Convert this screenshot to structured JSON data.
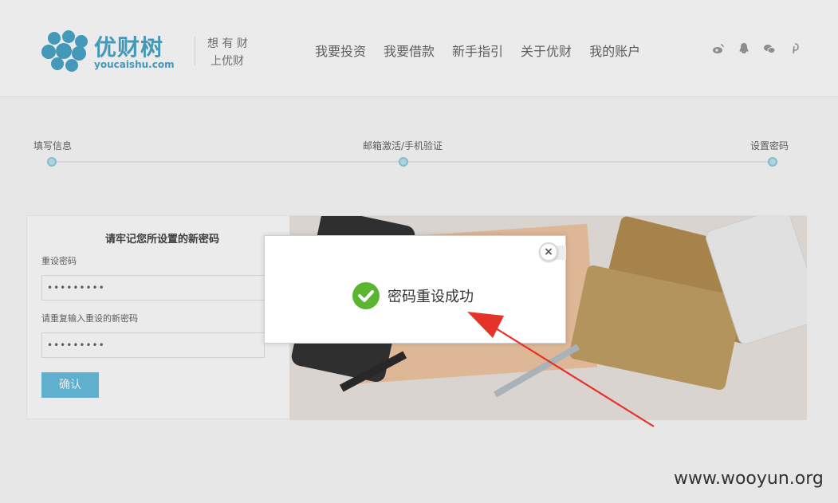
{
  "header": {
    "logo_cn": "优财树",
    "logo_en": "youcaishu.com",
    "slogan_line1": "想 有 财",
    "slogan_line2": "上优财",
    "nav": [
      "我要投资",
      "我要借款",
      "新手指引",
      "关于优财",
      "我的账户"
    ],
    "social_icons": [
      "weibo-icon",
      "qq-icon",
      "wechat-icon",
      "pinterest-icon"
    ]
  },
  "steps": {
    "items": [
      "填写信息",
      "邮箱激活/手机验证",
      "设置密码"
    ]
  },
  "form": {
    "title": "请牢记您所设置的新密码",
    "password_label": "重设密码",
    "password_value": "•••••••••",
    "confirm_label": "请重复输入重设的新密码",
    "confirm_value": "•••••••••",
    "submit_label": "确认"
  },
  "modal": {
    "message": "密码重设成功",
    "close_symbol": "×"
  },
  "watermark": "www.wooyun.org",
  "colors": {
    "brand": "#4aa6c9",
    "success": "#5cb531",
    "arrow": "#e5332a"
  }
}
